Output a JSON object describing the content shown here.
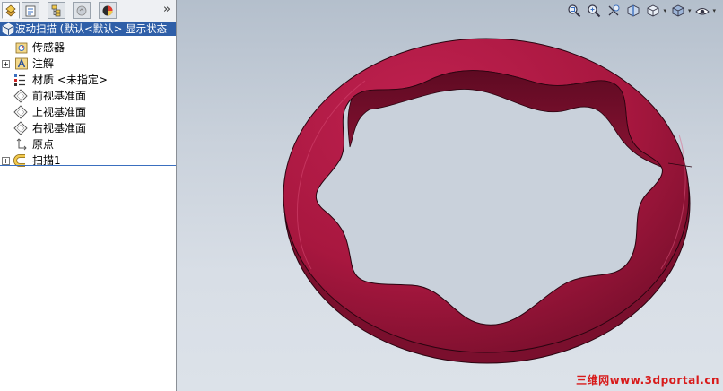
{
  "tabs": [
    {
      "name": "featuremanager"
    },
    {
      "name": "propertymanager"
    },
    {
      "name": "configurationmanager"
    },
    {
      "name": "dimxpert"
    },
    {
      "name": "display-manager"
    }
  ],
  "tab_more": "»",
  "tree": {
    "root_label": "波动扫描  (默认<默认> 显示状态",
    "items": [
      {
        "label": "传感器",
        "icon": "sensor-icon",
        "expandable": false
      },
      {
        "label": "注解",
        "icon": "annotation-icon",
        "expandable": true
      },
      {
        "label": "材质 <未指定>",
        "icon": "material-icon",
        "expandable": false
      },
      {
        "label": "前视基准面",
        "icon": "plane-icon",
        "expandable": false
      },
      {
        "label": "上视基准面",
        "icon": "plane-icon",
        "expandable": false
      },
      {
        "label": "右视基准面",
        "icon": "plane-icon",
        "expandable": false
      },
      {
        "label": "原点",
        "icon": "origin-icon",
        "expandable": false
      },
      {
        "label": "扫描1",
        "icon": "sweep-icon",
        "expandable": true
      }
    ]
  },
  "view_toolbar": [
    "zoom-to-fit-icon",
    "zoom-area-icon",
    "previous-view-icon",
    "section-view-icon",
    "view-orientation-icon",
    "display-style-icon",
    "hide-show-icon"
  ],
  "model_color": "#a8173f",
  "watermark": "三维网www.3dportal.cn"
}
